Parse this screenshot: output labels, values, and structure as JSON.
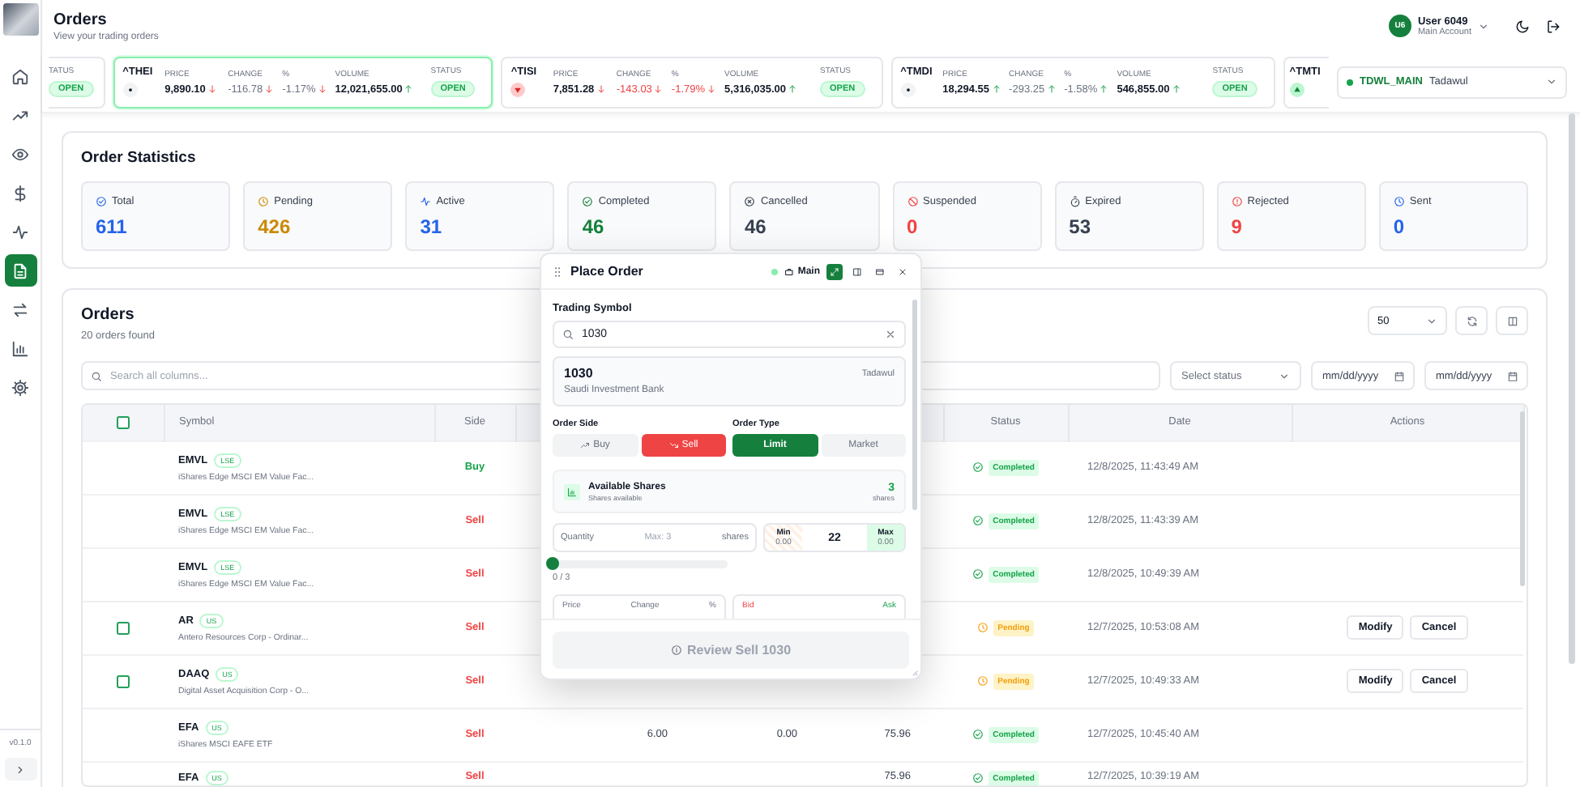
{
  "header": {
    "title": "Orders",
    "subtitle": "View your trading orders",
    "user": {
      "initials": "U6",
      "name": "User 6049",
      "account": "Main Account"
    }
  },
  "sidebar": {
    "items": [
      {
        "kind": "home",
        "selected": false
      },
      {
        "kind": "trend",
        "selected": false
      },
      {
        "kind": "eye",
        "selected": false
      },
      {
        "kind": "dollar",
        "selected": false
      },
      {
        "kind": "pulse",
        "selected": false
      },
      {
        "kind": "document",
        "selected": true
      },
      {
        "kind": "swap",
        "selected": false
      },
      {
        "kind": "bars",
        "selected": false
      },
      {
        "kind": "gear",
        "selected": false
      }
    ],
    "version": "v0.1.0"
  },
  "tickers": [
    {
      "kind": "tail",
      "status_label": "TATUS",
      "status": "OPEN"
    },
    {
      "kind": "full",
      "symbol": "^THEI",
      "marker": {
        "kind": "dot"
      },
      "active": true,
      "metrics": [
        {
          "label": "PRICE",
          "value": "9,890.10",
          "rising": false,
          "emphasized": true,
          "negative": false
        },
        {
          "label": "CHANGE",
          "value": "-116.78",
          "rising": false,
          "emphasized": false,
          "negative": false
        },
        {
          "label": "%",
          "value": "-1.17%",
          "rising": false,
          "emphasized": false,
          "negative": false
        },
        {
          "label": "VOLUME",
          "value": "12,021,655.00",
          "rising": true,
          "emphasized": true,
          "negative": false
        }
      ],
      "status_label": "STATUS",
      "status": "OPEN"
    },
    {
      "kind": "full",
      "symbol": "^TISI",
      "marker": {
        "kind": "down"
      },
      "active": false,
      "metrics": [
        {
          "label": "PRICE",
          "value": "7,851.28",
          "rising": false,
          "emphasized": true,
          "negative": false
        },
        {
          "label": "CHANGE",
          "value": "-143.03",
          "rising": false,
          "emphasized": false,
          "negative": true
        },
        {
          "label": "%",
          "value": "-1.79%",
          "rising": false,
          "emphasized": false,
          "negative": true
        },
        {
          "label": "VOLUME",
          "value": "5,316,035.00",
          "rising": true,
          "emphasized": true,
          "negative": false
        }
      ],
      "status_label": "STATUS",
      "status": "OPEN"
    },
    {
      "kind": "full",
      "symbol": "^TMDI",
      "marker": {
        "kind": "dot"
      },
      "active": false,
      "metrics": [
        {
          "label": "PRICE",
          "value": "18,294.55",
          "rising": true,
          "emphasized": true,
          "negative": false
        },
        {
          "label": "CHANGE",
          "value": "-293.25",
          "rising": true,
          "emphasized": false,
          "negative": false
        },
        {
          "label": "%",
          "value": "-1.58%",
          "rising": true,
          "emphasized": false,
          "negative": false
        },
        {
          "label": "VOLUME",
          "value": "546,855.00",
          "rising": true,
          "emphasized": true,
          "negative": false
        }
      ],
      "status_label": "STATUS",
      "status": "OPEN"
    },
    {
      "kind": "head",
      "symbol": "^TMTI",
      "marker": {
        "kind": "up"
      }
    }
  ],
  "market_select": {
    "code": "TDWL_MAIN",
    "name": "Tadawul"
  },
  "statistics": {
    "title": "Order Statistics",
    "tiles": [
      {
        "kind": "total",
        "label": "Total",
        "value": "611",
        "color": "#2563eb"
      },
      {
        "kind": "pending",
        "label": "Pending",
        "value": "426",
        "color": "#ca8a04"
      },
      {
        "kind": "active",
        "label": "Active",
        "value": "31",
        "color": "#2563eb"
      },
      {
        "kind": "completed",
        "label": "Completed",
        "value": "46",
        "color": "#15803d"
      },
      {
        "kind": "cancelled",
        "label": "Cancelled",
        "value": "46",
        "color": "#374151"
      },
      {
        "kind": "suspended",
        "label": "Suspended",
        "value": "0",
        "color": "#ef4444"
      },
      {
        "kind": "expired",
        "label": "Expired",
        "value": "53",
        "color": "#374151"
      },
      {
        "kind": "rejected",
        "label": "Rejected",
        "value": "9",
        "color": "#ef4444"
      },
      {
        "kind": "sent",
        "label": "Sent",
        "value": "0",
        "color": "#2563eb"
      }
    ]
  },
  "orders": {
    "title": "Orders",
    "count": "20 orders found",
    "page_size": "50",
    "search_placeholder": "Search all columns...",
    "status_placeholder": "Select status",
    "date_placeholders": [
      "mm/dd/yyyy",
      "mm/dd/yyyy"
    ],
    "select_all": {
      "checked": false
    },
    "columns": [
      "Symbol",
      "Side",
      "Status",
      "Date",
      "Actions"
    ],
    "rows": [
      {
        "symbol": "EMVL",
        "exchange": "LSE",
        "name": "iShares Edge MSCI EM Value Fac...",
        "side": {
          "label": "Buy",
          "kind": "buy"
        },
        "status": {
          "label": "Completed",
          "kind": "completed"
        },
        "date": "12/8/2025, 11:43:49 AM"
      },
      {
        "symbol": "EMVL",
        "exchange": "LSE",
        "name": "iShares Edge MSCI EM Value Fac...",
        "side": {
          "label": "Sell",
          "kind": "sell"
        },
        "status": {
          "label": "Completed",
          "kind": "completed"
        },
        "date": "12/8/2025, 11:43:39 AM"
      },
      {
        "symbol": "EMVL",
        "exchange": "LSE",
        "name": "iShares Edge MSCI EM Value Fac...",
        "side": {
          "label": "Sell",
          "kind": "sell"
        },
        "status": {
          "label": "Completed",
          "kind": "completed"
        },
        "date": "12/8/2025, 10:49:39 AM"
      },
      {
        "checked": false,
        "symbol": "AR",
        "exchange": "US",
        "name": "Antero Resources Corp - Ordinar...",
        "side": {
          "label": "Sell",
          "kind": "sell"
        },
        "status": {
          "label": "Pending",
          "kind": "pending"
        },
        "date": "12/7/2025, 10:53:08 AM",
        "actions": [
          "Modify",
          "Cancel"
        ]
      },
      {
        "checked": false,
        "symbol": "DAAQ",
        "exchange": "US",
        "name": "Digital Asset Acquisition Corp - O...",
        "side": {
          "label": "Sell",
          "kind": "sell"
        },
        "status": {
          "label": "Pending",
          "kind": "pending"
        },
        "date": "12/7/2025, 10:49:33 AM",
        "actions": [
          "Modify",
          "Cancel"
        ]
      },
      {
        "symbol": "EFA",
        "exchange": "US",
        "name": "iShares MSCI EAFE ETF",
        "side": {
          "label": "Sell",
          "kind": "sell"
        },
        "column_4": "6.00",
        "column_5": "0.00",
        "column_6": "75.96",
        "status": {
          "label": "Completed",
          "kind": "completed"
        },
        "date": "12/7/2025, 10:45:40 AM"
      },
      {
        "symbol": "EFA",
        "exchange": "US",
        "side": {
          "label": "Sell",
          "kind": "sell"
        },
        "column_6": "75.96",
        "status": {
          "label": "Completed",
          "kind": "completed"
        },
        "date": "12/7/2025, 10:39:19 AM"
      }
    ]
  },
  "order_dialog": {
    "title": "Place Order",
    "account": "Main",
    "symbol_label": "Trading Symbol",
    "symbol_query": "1030",
    "result": {
      "code": "1030",
      "exchange": "Tadawul",
      "name": "Saudi Investment Bank"
    },
    "side_label": "Order Side",
    "sides": [
      {
        "label": "Buy",
        "kind": "buy",
        "selected": false
      },
      {
        "label": "Sell",
        "kind": "sell",
        "selected": true
      }
    ],
    "type_label": "Order Type",
    "types": [
      {
        "label": "Limit",
        "selected": true
      },
      {
        "label": "Market",
        "selected": false
      }
    ],
    "available": {
      "title": "Available Shares",
      "subtitle": "Shares available",
      "count": "3",
      "unit": "shares"
    },
    "quantity": {
      "label": "Quantity",
      "placeholder": "Max: 3",
      "unit": "shares",
      "level": 0,
      "reading": "0 / 3"
    },
    "price": {
      "min_label": "Min",
      "min": "0.00",
      "value": "22",
      "max_label": "Max",
      "max": "0.00"
    },
    "quote_headers": [
      "Price",
      "Change",
      "%"
    ],
    "book_headers": [
      {
        "label": "Bid",
        "kind": "bid"
      },
      {
        "label": "Ask",
        "kind": "ask"
      }
    ],
    "submit": {
      "label": "Review Sell 1030",
      "disabled": true
    }
  }
}
